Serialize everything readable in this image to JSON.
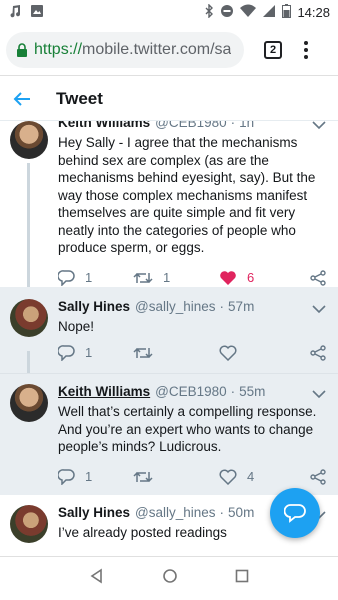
{
  "status": {
    "time": "14:28"
  },
  "browser": {
    "url_scheme": "https://",
    "url_rest": "mobile.twitter.com/sa",
    "tab_count": "2"
  },
  "header": {
    "title": "Tweet"
  },
  "tweets": [
    {
      "name": "Keith Williams",
      "handle": "@CEB1980",
      "time": "1h",
      "text": "Hey Sally - I agree that the mechanisms behind sex are complex (as are the mechanisms behind eyesight, say). But the way those complex mechanisms manifest themselves are quite simple and fit very neatly into the categories of people who produce sperm, or eggs.",
      "replies": "1",
      "retweets": "1",
      "likes": "6"
    },
    {
      "name": "Sally Hines",
      "handle": "@sally_hines",
      "time": "57m",
      "text": "Nope!",
      "replies": "1"
    },
    {
      "name": "Keith Williams",
      "handle": "@CEB1980",
      "time": "55m",
      "text": "Well that’s certainly a compelling response. And you’re an expert who wants to change people’s minds? Ludicrous.",
      "replies": "1",
      "likes": "4"
    },
    {
      "name": "Sally Hines",
      "handle": "@sally_hines",
      "time": "50m",
      "text": "I’ve already posted readings"
    }
  ]
}
